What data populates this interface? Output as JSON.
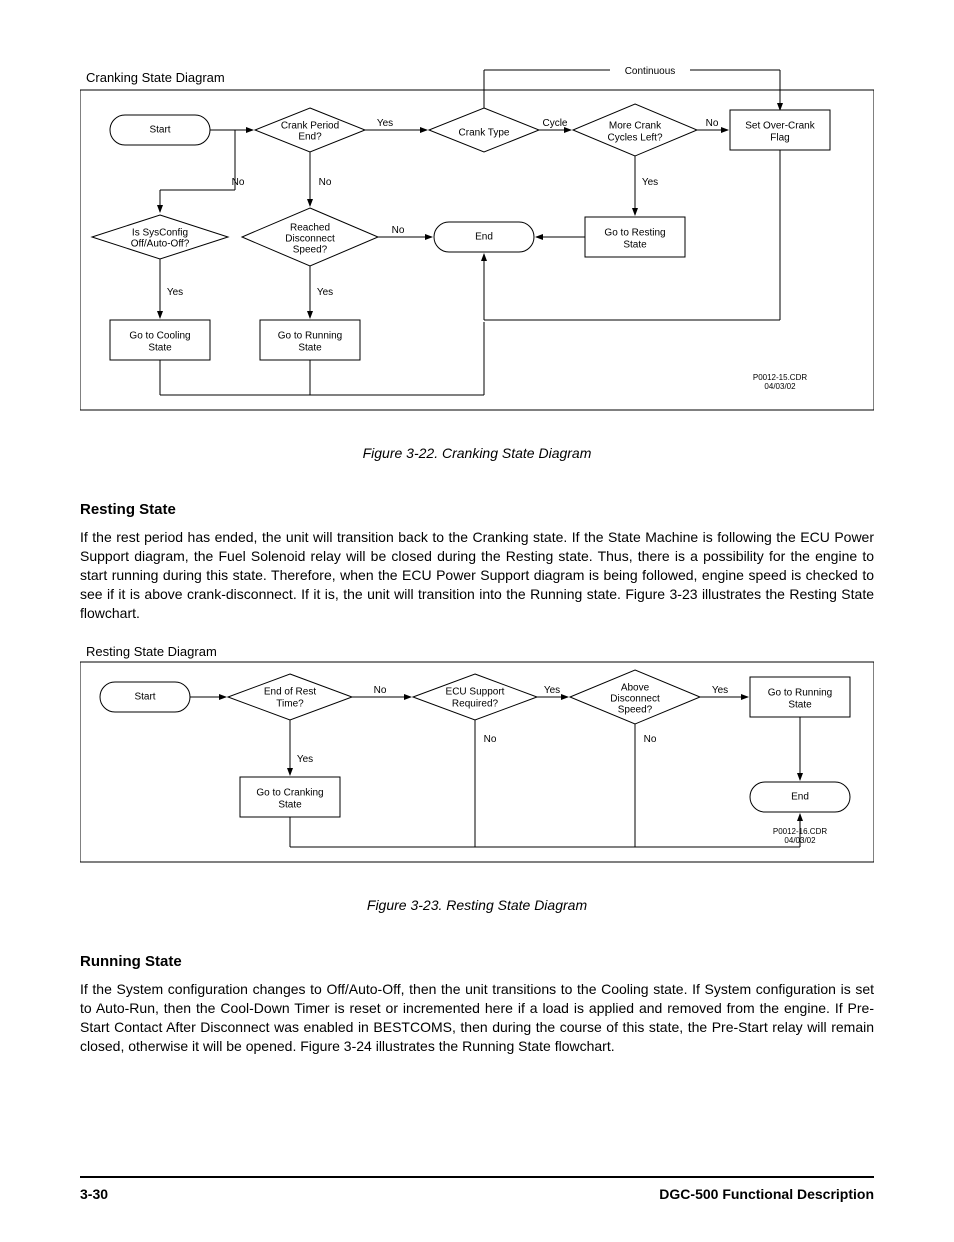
{
  "figure1": {
    "title": "Cranking State Diagram",
    "caption": "Figure 3-22. Cranking State Diagram",
    "marks": "P0012-15.CDR\n04/03/02",
    "nodes": {
      "start": "Start",
      "crankPeriodEnd": "Crank Period\nEnd?",
      "crankType": "Crank Type",
      "moreCrank": "More Crank\nCycles Left?",
      "setOverCrank": "Set Over-Crank\nFlag",
      "isSysConfig": "Is SysConfig\nOff/Auto-Off?",
      "reachedDisc": "Reached\nDisconnect\nSpeed?",
      "end": "End",
      "goResting": "Go to Resting\nState",
      "goCooling": "Go to Cooling\nState",
      "goRunning": "Go to Running\nState"
    },
    "labels": {
      "yes": "Yes",
      "no": "No",
      "cycle": "Cycle",
      "continuous": "Continuous"
    }
  },
  "section1": {
    "heading": "Resting State",
    "body": "If the rest period has ended, the unit will transition back to the Cranking state. If the State Machine is following the ECU Power Support diagram, the Fuel Solenoid relay will be closed during the Resting state. Thus, there is a possibility for the engine to start running during this state. Therefore, when the ECU Power Support diagram is being followed, engine speed is checked to see if it is above crank-disconnect. If it is, the unit will transition into the Running state. Figure 3-23 illustrates the Resting State flowchart."
  },
  "figure2": {
    "title": "Resting State Diagram",
    "caption": "Figure 3-23. Resting State Diagram",
    "marks": "P0012-16.CDR\n04/03/02",
    "nodes": {
      "start": "Start",
      "endRest": "End of Rest\nTime?",
      "ecuSupport": "ECU Support\nRequired?",
      "aboveDisc": "Above\nDisconnect\nSpeed?",
      "goRunning": "Go to Running\nState",
      "goCranking": "Go to Cranking\nState",
      "end": "End"
    },
    "labels": {
      "yes": "Yes",
      "no": "No"
    }
  },
  "section2": {
    "heading": "Running State",
    "body": "If the System configuration changes to Off/Auto-Off, then the unit transitions to the Cooling state. If System configuration is set to Auto-Run, then the Cool-Down Timer is reset or incremented here if a load is applied and removed from the engine. If Pre-Start Contact After Disconnect was enabled in BESTCOMS, then during the course of this state, the Pre-Start relay will remain closed, otherwise it will be opened. Figure 3-24 illustrates the Running State flowchart."
  },
  "footer": {
    "left": "3-30",
    "right": "DGC-500 Functional Description"
  }
}
